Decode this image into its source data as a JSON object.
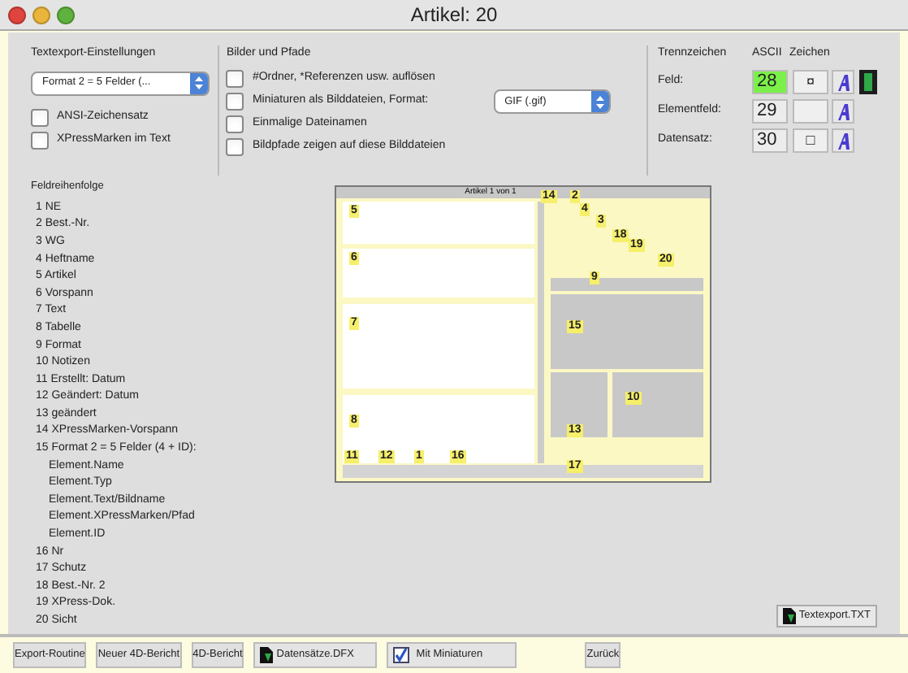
{
  "window": {
    "title": "Artikel: 20"
  },
  "textexport": {
    "title": "Textexport-Einstellungen",
    "format_popup": "Format 2 = 5 Felder (...",
    "options": [
      {
        "label": "ANSI-Zeichensatz",
        "checked": false
      },
      {
        "label": "XPressMarken im Text",
        "checked": false
      }
    ]
  },
  "images": {
    "title": "Bilder und Pfade",
    "options": [
      {
        "label": "#Ordner, *Referenzen usw. auflösen",
        "checked": false
      },
      {
        "label": "Miniaturen als Bilddateien, Format:",
        "checked": false
      },
      {
        "label": "Einmalige Dateinamen",
        "checked": false
      },
      {
        "label": "Bildpfade zeigen auf diese Bilddateien",
        "checked": false
      }
    ],
    "format_popup": "GIF (.gif)"
  },
  "separators": {
    "title": "Trennzeichen",
    "ascii_header": "ASCII",
    "char_header": "Zeichen",
    "rows": [
      {
        "label": "Feld:",
        "ascii": "28",
        "char": "¤",
        "highlighted": true
      },
      {
        "label": "Elementfeld:",
        "ascii": "29",
        "char": "",
        "highlighted": false
      },
      {
        "label": "Datensatz:",
        "ascii": "30",
        "char": "□",
        "highlighted": false
      }
    ]
  },
  "field_order": {
    "title": "Feldreihenfolge",
    "items": [
      {
        "label": "1 NE"
      },
      {
        "label": "2 Best.-Nr."
      },
      {
        "label": "3 WG"
      },
      {
        "label": "4 Heftname"
      },
      {
        "label": "5 Artikel"
      },
      {
        "label": "6 Vorspann"
      },
      {
        "label": "7 Text"
      },
      {
        "label": "8 Tabelle"
      },
      {
        "label": "9 Format"
      },
      {
        "label": "10 Notizen"
      },
      {
        "label": "11 Erstellt: Datum"
      },
      {
        "label": "12 Geändert: Datum"
      },
      {
        "label": "13 geändert"
      },
      {
        "label": "14 XPressMarken-Vorspann"
      },
      {
        "label": "15 Format 2 = 5 Felder (4 + ID):",
        "children": [
          {
            "label": "Element.Name"
          },
          {
            "label": "Element.Typ"
          },
          {
            "label": "Element.Text/Bildname"
          },
          {
            "label": "Element.XPressMarken/Pfad"
          },
          {
            "label": "Element.ID"
          }
        ]
      },
      {
        "label": "16 Nr"
      },
      {
        "label": "17 Schutz"
      },
      {
        "label": "18 Best.-Nr. 2"
      },
      {
        "label": "19 XPress-Dok."
      },
      {
        "label": "20 Sicht"
      }
    ]
  },
  "preview": {
    "title": "Artikel 1 von 1",
    "labels": [
      "5",
      "6",
      "7",
      "8",
      "11",
      "12",
      "1",
      "16",
      "14",
      "2",
      "4",
      "3",
      "18",
      "19",
      "20",
      "9",
      "15",
      "10",
      "13",
      "17"
    ]
  },
  "export_file_button": "Textexport.TXT",
  "buttons": [
    {
      "label": "Export-Routine",
      "kind": "plain"
    },
    {
      "label": "Neuer 4D-Bericht",
      "kind": "plain"
    },
    {
      "label": "4D-Bericht",
      "kind": "plain"
    },
    {
      "label": "Datensätze.DFX",
      "kind": "file"
    },
    {
      "label": "Mit Miniaturen",
      "kind": "checkbox",
      "checked": true
    },
    {
      "label": "Zurück",
      "kind": "plain"
    }
  ]
}
